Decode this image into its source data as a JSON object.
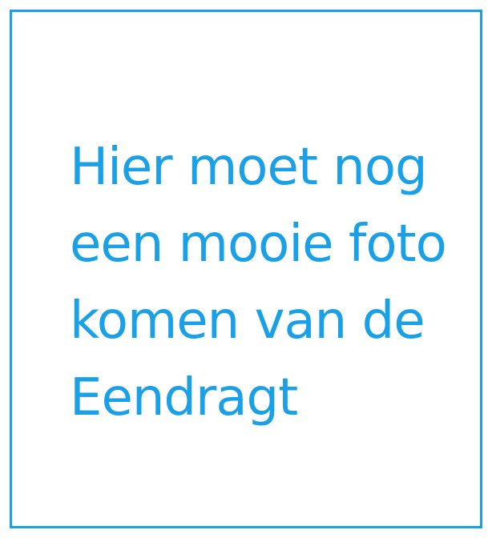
{
  "placeholder": {
    "lines": [
      "Hier moet nog",
      "een mooie foto",
      "komen van de",
      "Eendragt"
    ]
  },
  "colors": {
    "accent": "#1aa0e6",
    "background": "#ffffff"
  }
}
